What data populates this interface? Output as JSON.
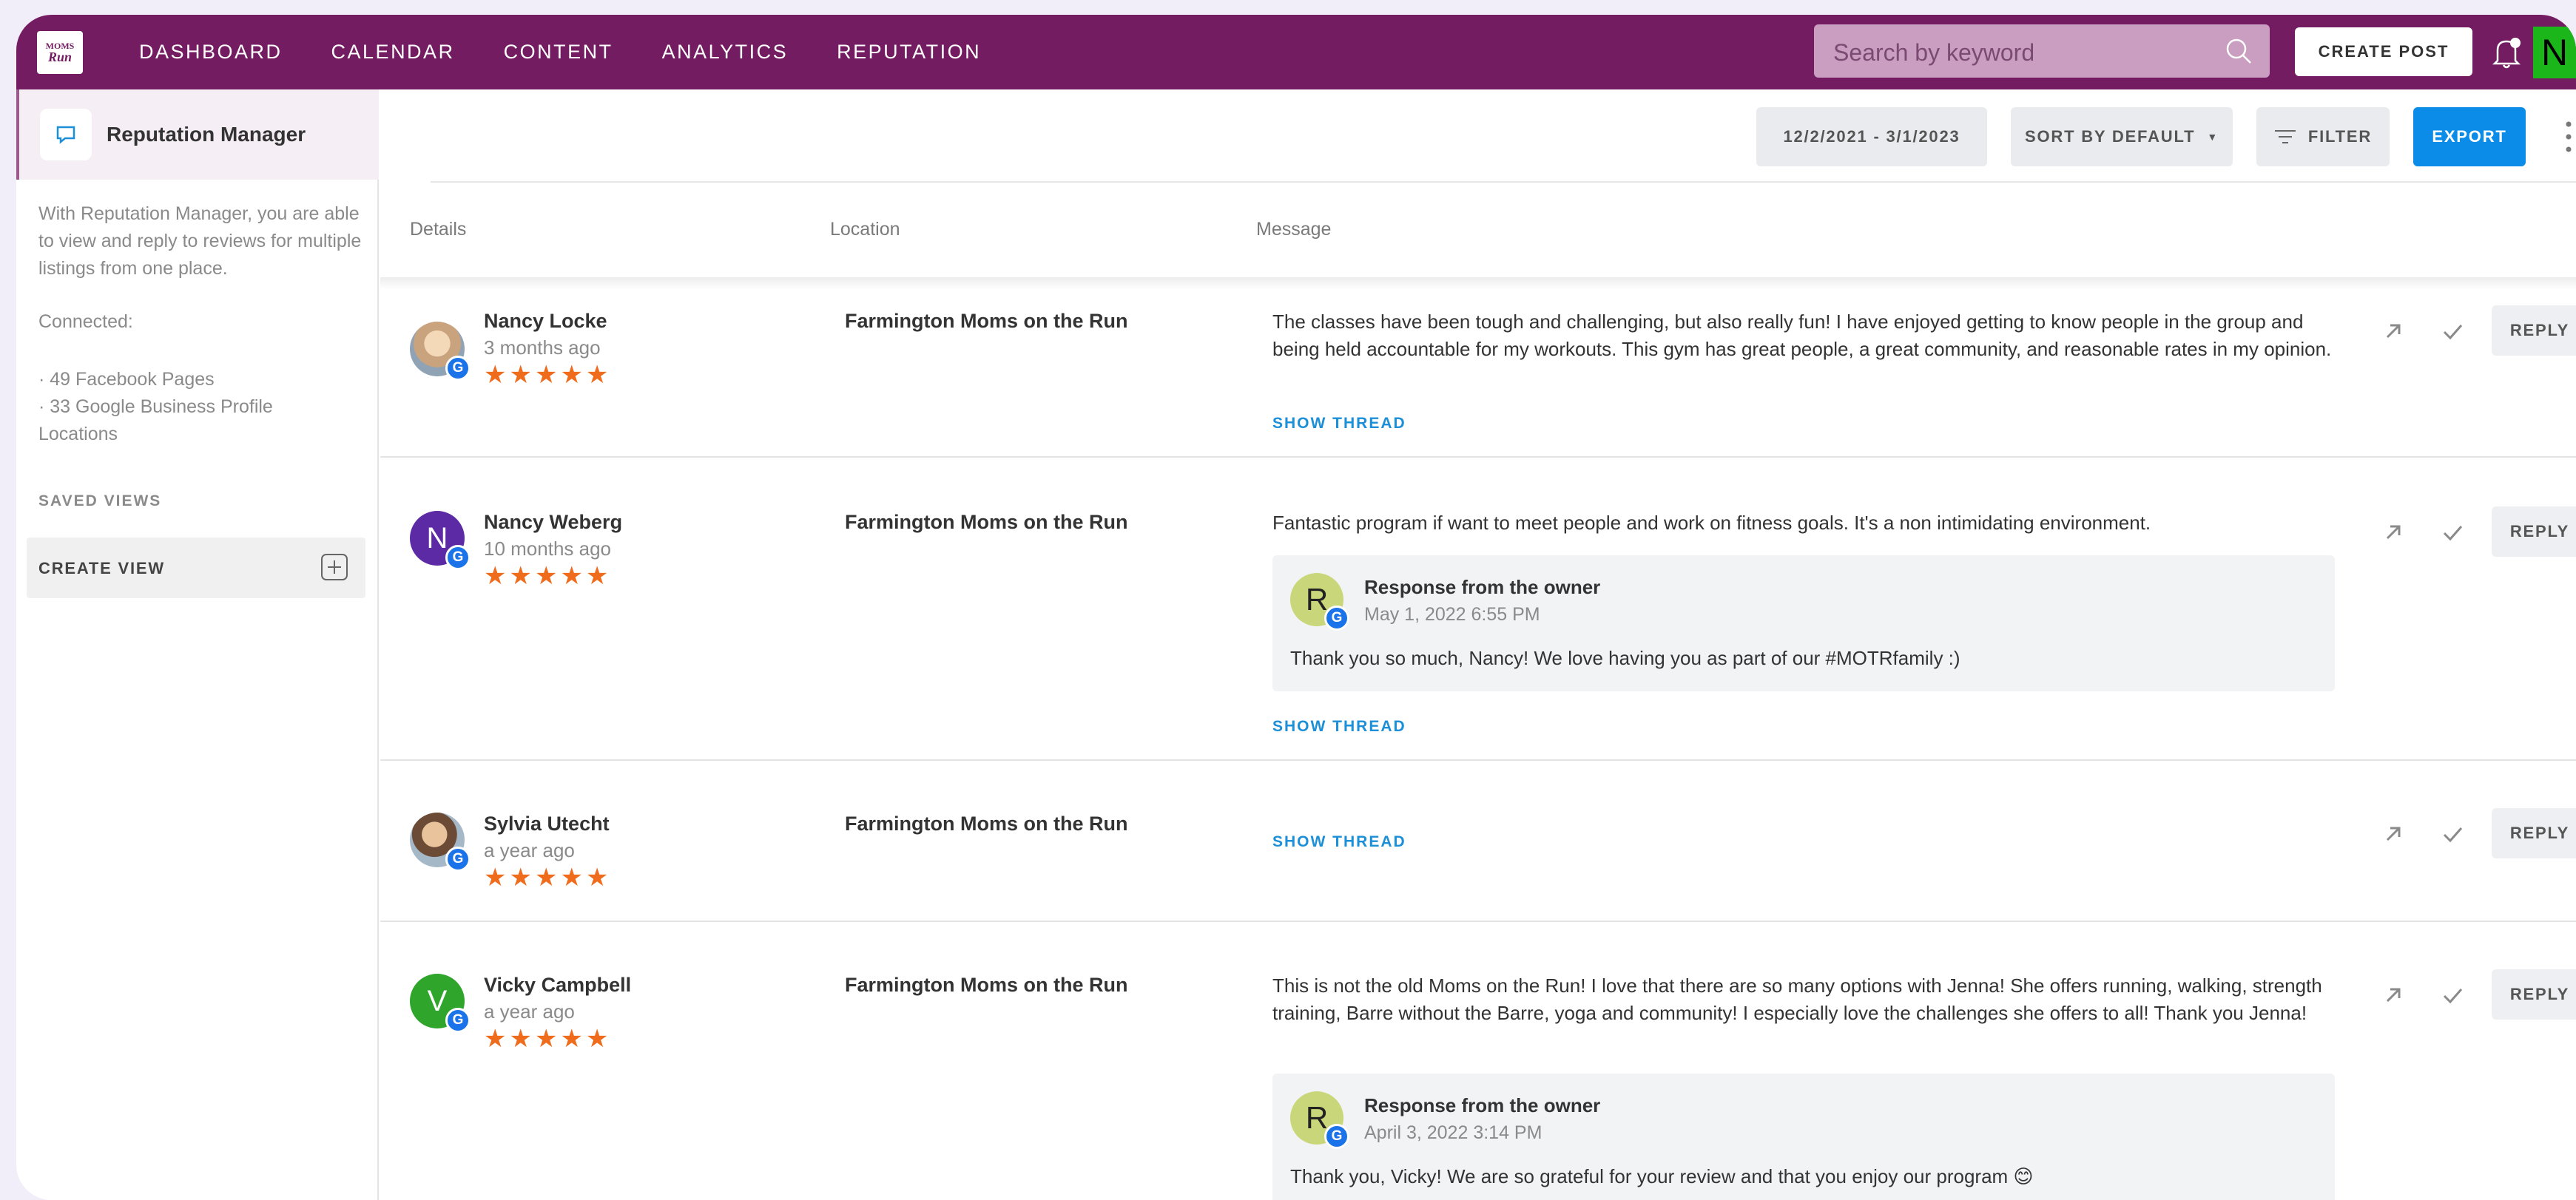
{
  "topbar": {
    "logo_line1": "MOMS",
    "logo_line2": "Run",
    "nav": [
      "DASHBOARD",
      "CALENDAR",
      "CONTENT",
      "ANALYTICS",
      "REPUTATION"
    ],
    "search_placeholder": "Search by keyword",
    "create_post": "CREATE POST",
    "user_initial": "N",
    "accent_color": "#741c62"
  },
  "sidebar": {
    "title": "Reputation Manager",
    "description": "With Reputation Manager, you are able to view and reply to reviews for multiple listings from one place.",
    "connected_label": "Connected:",
    "facebook": "· 49 Facebook Pages",
    "google": "· 33 Google Business Profile Locations",
    "saved_views": "SAVED VIEWS",
    "create_view": "CREATE VIEW"
  },
  "toolbar": {
    "date_range": "12/2/2021 - 3/1/2023",
    "sort": "SORT BY DEFAULT",
    "filter": "FILTER",
    "export": "EXPORT"
  },
  "table": {
    "col_details": "Details",
    "col_location": "Location",
    "col_message": "Message",
    "reply_label": "REPLY",
    "show_thread": "SHOW THREAD",
    "stars": "★★★★★",
    "badge": "G",
    "rows": [
      {
        "name": "Nancy Locke",
        "time": "3 months ago",
        "location": "Farmington Moms on the Run",
        "message": "The classes have been tough and challenging, but also really fun! I have enjoyed getting to know people in the group and being held accountable for my workouts. This gym has great people, a great community, and reasonable rates in my opinion."
      },
      {
        "name": "Nancy Weberg",
        "initial": "N",
        "time": "10 months ago",
        "location": "Farmington Moms on the Run",
        "message": "Fantastic program if want to meet people and work on fitness goals. It's a non intimidating environment.",
        "owner_initial": "R",
        "owner_title": "Response from the owner",
        "owner_date": "May 1, 2022 6:55 PM",
        "owner_text": "Thank you so much, Nancy! We love having you as part of our #MOTRfamily :)"
      },
      {
        "name": "Sylvia Utecht",
        "time": "a year ago",
        "location": "Farmington Moms on the Run"
      },
      {
        "name": "Vicky Campbell",
        "initial": "V",
        "time": "a year ago",
        "location": "Farmington Moms on the Run",
        "message": "This is not the old Moms on the Run! I love that there are so many options with Jenna! She offers running, walking, strength training, Barre without the Barre, yoga and community! I especially love the challenges she offers to all! Thank you Jenna!",
        "owner_initial": "R",
        "owner_title": "Response from the owner",
        "owner_date": "April 3, 2022 3:14 PM",
        "owner_text": "Thank you, Vicky! We are so grateful for your review and that you enjoy our program 😊"
      }
    ]
  }
}
